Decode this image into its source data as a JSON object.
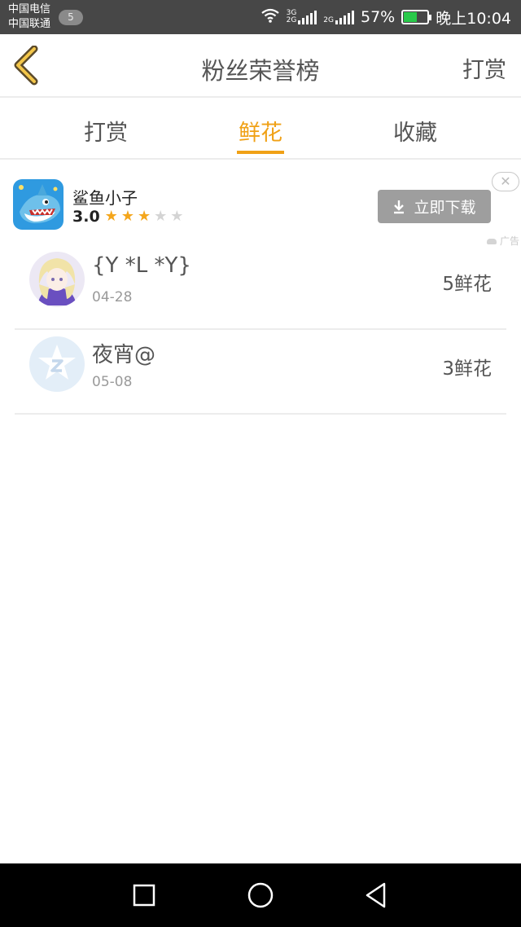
{
  "status_bar": {
    "carrier_1": "中国电信",
    "carrier_2": "中国联通",
    "notification_count": "5",
    "net_3g": "3G",
    "net_2g_a": "2G",
    "net_2g_b": "2G",
    "battery_percent": "57%",
    "battery_level": 0.57,
    "time": "晚上10:04"
  },
  "header": {
    "title": "粉丝荣誉榜",
    "right_action": "打赏"
  },
  "tabs": [
    {
      "label": "打赏",
      "active": false
    },
    {
      "label": "鲜花",
      "active": true
    },
    {
      "label": "收藏",
      "active": false
    }
  ],
  "ad": {
    "app_name": "鲨鱼小子",
    "rating": "3.0",
    "stars_filled": 3,
    "stars_total": 5,
    "download_label": "立即下载",
    "close_glyph": "✕",
    "ad_label": "广告"
  },
  "fans": [
    {
      "name": "{Y *L *Y}",
      "date": "04-28",
      "count": "5鲜花"
    },
    {
      "name": "夜宵@",
      "date": "05-08",
      "count": "3鲜花"
    }
  ],
  "colors": {
    "accent": "#f0a116",
    "status_bar": "#474747",
    "nav_bar": "#000000"
  }
}
